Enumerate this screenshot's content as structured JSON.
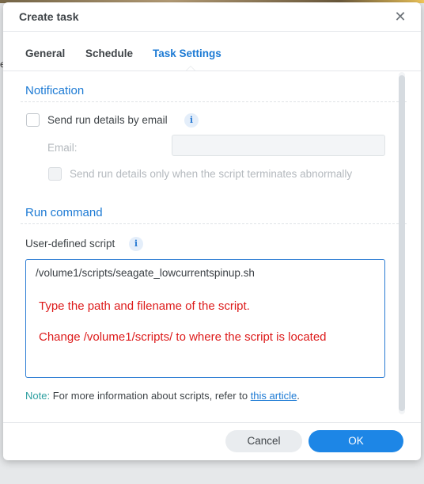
{
  "dialog": {
    "title": "Create task",
    "close_icon": "close-icon"
  },
  "tabs": [
    {
      "label": "General",
      "active": false
    },
    {
      "label": "Schedule",
      "active": false
    },
    {
      "label": "Task Settings",
      "active": true
    }
  ],
  "notification": {
    "section_title": "Notification",
    "send_email_label": "Send run details by email",
    "send_email_checked": false,
    "email_label": "Email:",
    "email_value": "",
    "abnormal_only_label": "Send run details only when the script terminates abnormally",
    "abnormal_only_checked": false
  },
  "run_command": {
    "section_title": "Run command",
    "script_label": "User-defined script",
    "script_value": "/volume1/scripts/seagate_lowcurrentspinup.sh",
    "annotation_1": "Type the path and filename of the script.",
    "annotation_2": "Change /volume1/scripts/ to where the script is located"
  },
  "note": {
    "prefix": "Note:",
    "text": " For more information about scripts, refer to ",
    "link": "this article",
    "suffix": "."
  },
  "footer": {
    "cancel_label": "Cancel",
    "ok_label": "OK"
  },
  "background": {
    "fragment": "e"
  },
  "colors": {
    "accent": "#1c7ad4",
    "primary_button": "#1d86e6",
    "annotation": "#dd1b1b",
    "note_prefix": "#2c9fa0"
  }
}
